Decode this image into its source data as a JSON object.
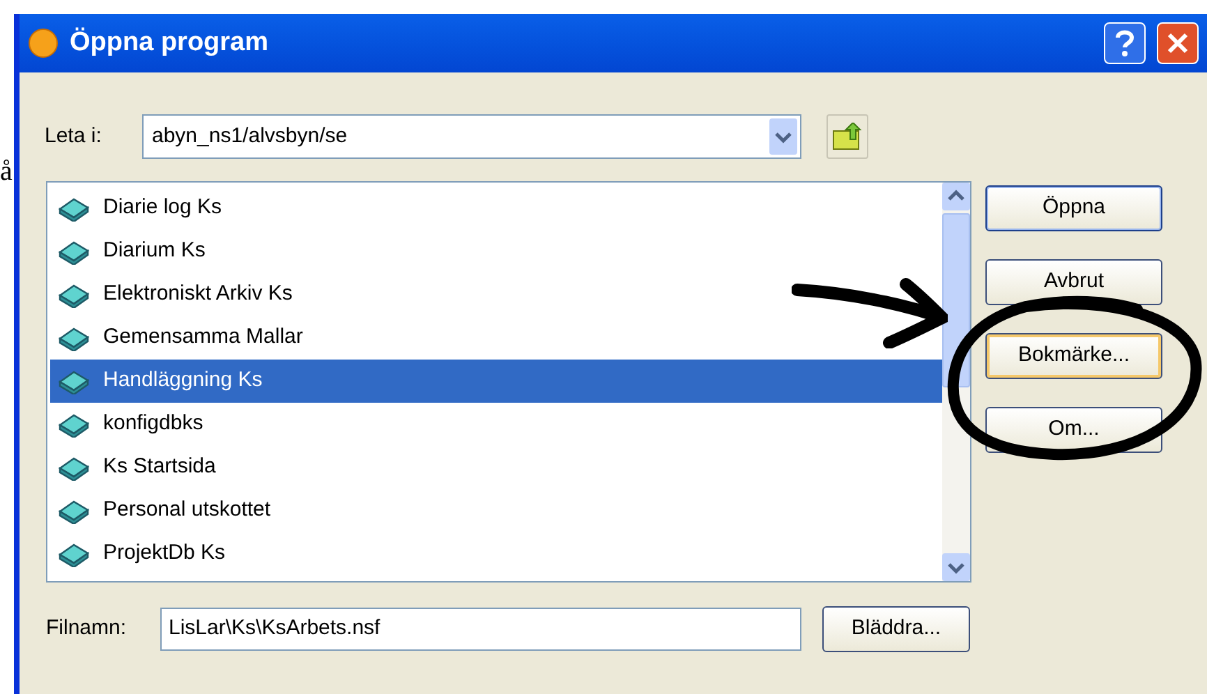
{
  "background_text": "å",
  "window": {
    "title": "Öppna program"
  },
  "look_in": {
    "label": "Leta i:",
    "value": "abyn_ns1/alvsbyn/se"
  },
  "files": [
    {
      "name": "Diarie log Ks",
      "selected": false
    },
    {
      "name": "Diarium Ks",
      "selected": false
    },
    {
      "name": "Elektroniskt Arkiv Ks",
      "selected": false
    },
    {
      "name": "Gemensamma Mallar",
      "selected": false
    },
    {
      "name": "Handläggning Ks",
      "selected": true
    },
    {
      "name": "konfigdbks",
      "selected": false
    },
    {
      "name": "Ks Startsida",
      "selected": false
    },
    {
      "name": "Personal utskottet",
      "selected": false
    },
    {
      "name": "ProjektDb Ks",
      "selected": false
    }
  ],
  "buttons": [
    {
      "label": "Öppna",
      "kind": "default"
    },
    {
      "label": "Avbrut",
      "kind": "normal"
    },
    {
      "label": "Bokmärke...",
      "kind": "hover"
    },
    {
      "label": "Om...",
      "kind": "normal"
    }
  ],
  "filename": {
    "label": "Filnamn:",
    "value": "LisLar\\Ks\\KsArbets.nsf",
    "browse": "Bläddra..."
  }
}
